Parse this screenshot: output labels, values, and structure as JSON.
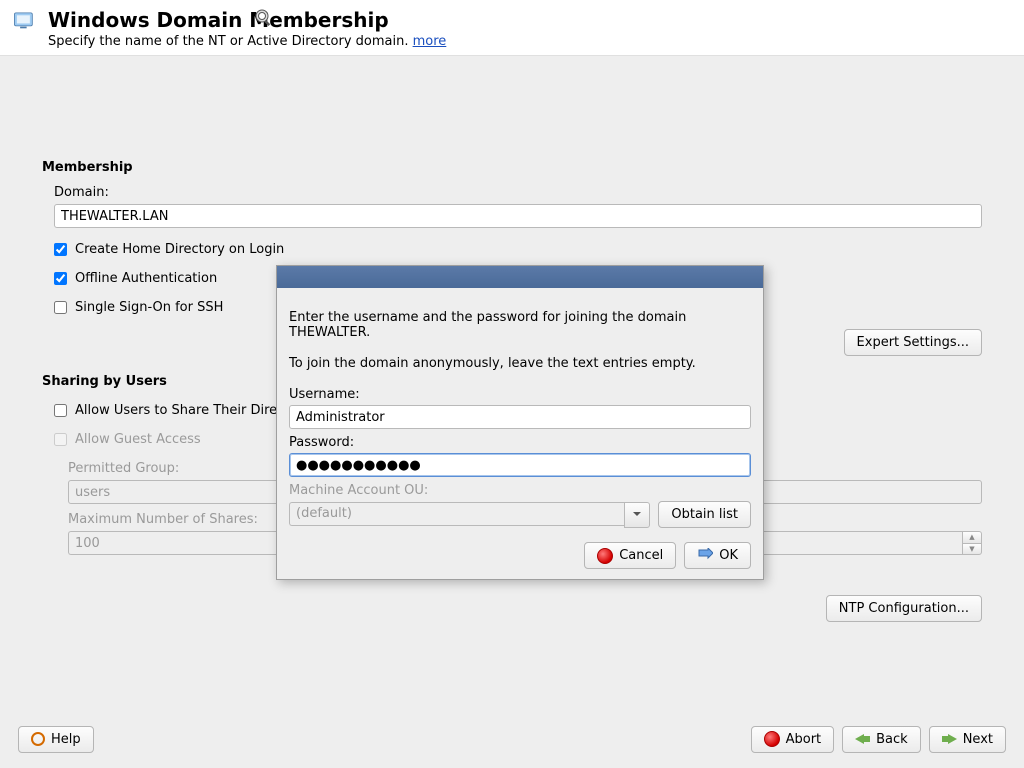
{
  "header": {
    "title": "Windows Domain Membership",
    "subtitle_prefix": "Specify the name of the NT or Active Directory domain. ",
    "more_link": "more"
  },
  "membership": {
    "section_title": "Membership",
    "domain_label": "Domain:",
    "domain_value": "THEWALTER.LAN",
    "create_home_label": "Create Home Directory on Login",
    "create_home_checked": true,
    "offline_auth_label": "Offline Authentication",
    "offline_auth_checked": true,
    "sso_ssh_label": "Single Sign-On for SSH",
    "sso_ssh_checked": false,
    "expert_button": "Expert Settings..."
  },
  "sharing": {
    "section_title": "Sharing by Users",
    "allow_share_label": "Allow Users to Share Their Dire",
    "allow_share_checked": false,
    "allow_guest_label": "Allow Guest Access",
    "allow_guest_checked": false,
    "permitted_group_label": "Permitted Group:",
    "permitted_group_value": "users",
    "max_shares_label": "Maximum Number of Shares:",
    "max_shares_value": "100",
    "ntp_button": "NTP Configuration..."
  },
  "footer": {
    "help": "Help",
    "abort": "Abort",
    "back": "Back",
    "next": "Next"
  },
  "dialog": {
    "line1": "Enter the username and the password for joining the domain THEWALTER.",
    "line2": "To join the domain anonymously, leave the text entries empty.",
    "username_label": "Username:",
    "username_value": "Administrator",
    "password_label": "Password:",
    "password_value": "●●●●●●●●●●●",
    "ou_label": "Machine Account OU:",
    "ou_value": "(default)",
    "obtain_button": "Obtain list",
    "cancel": "Cancel",
    "ok": "OK"
  }
}
